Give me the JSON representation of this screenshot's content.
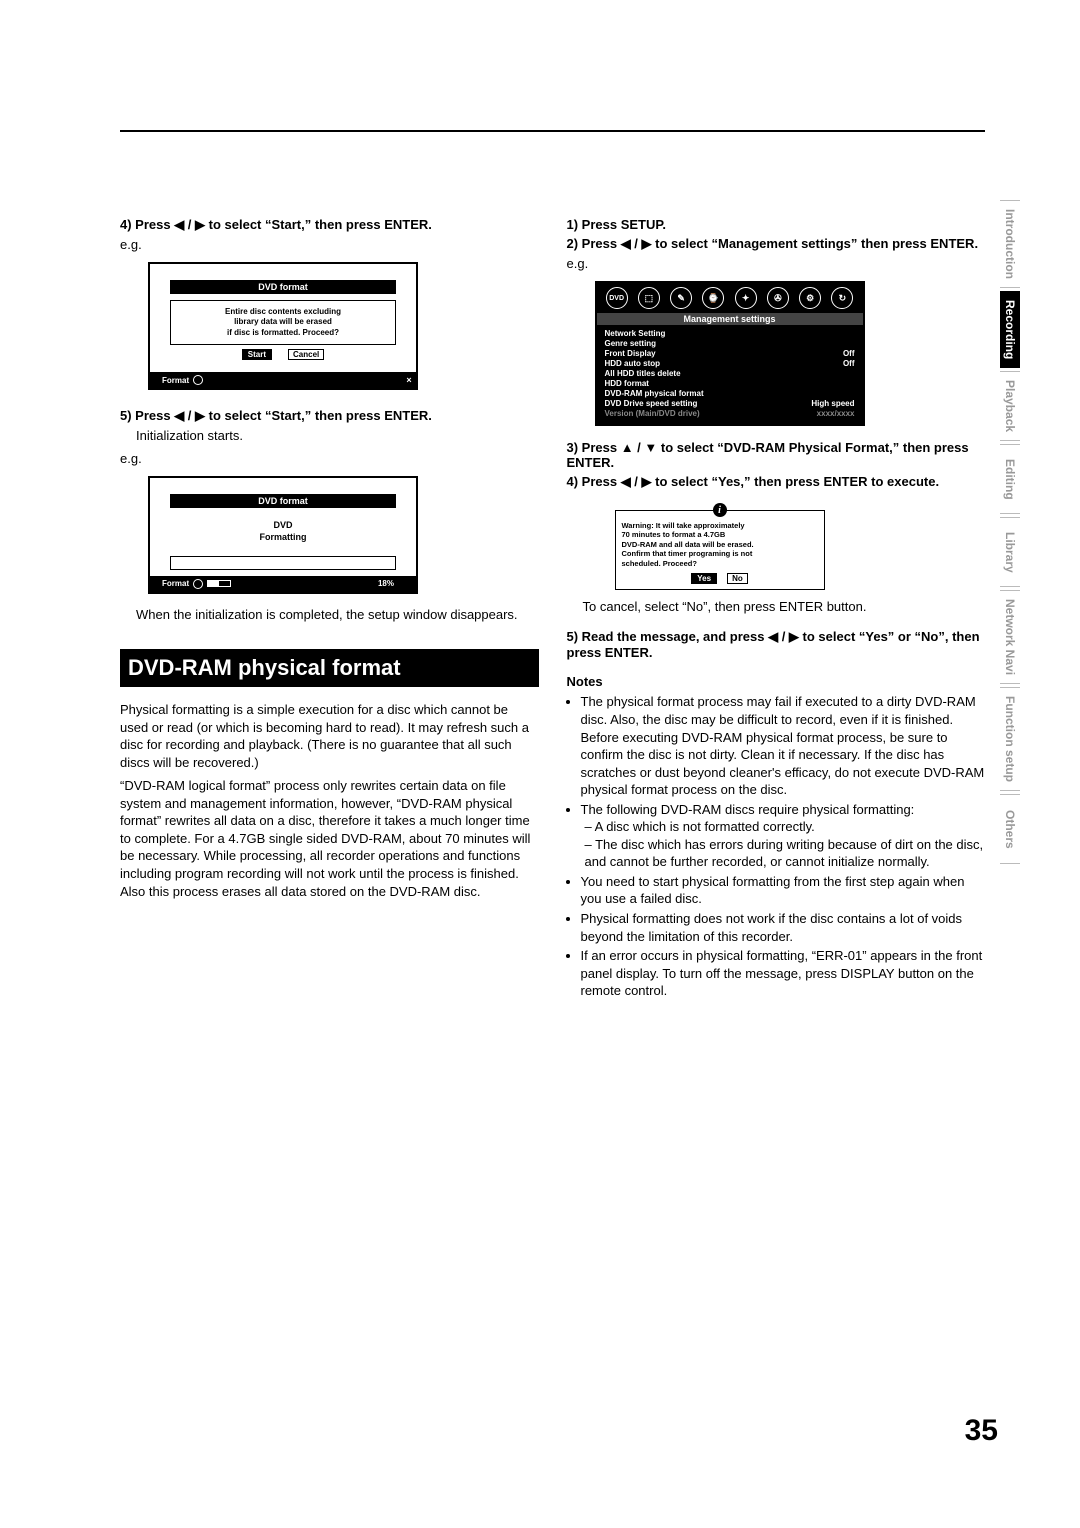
{
  "page_number": "35",
  "sidebar": [
    "Introduction",
    "Recording",
    "Playback",
    "Editing",
    "Library",
    "Network Navi",
    "Function setup",
    "Others"
  ],
  "sidebar_active": 1,
  "left": {
    "step4": "4) Press ◀ / ▶ to select “Start,” then press ENTER.",
    "eg": "e.g.",
    "diag1": {
      "title": "DVD format",
      "msg1": "Entire disc contents excluding",
      "msg2": "library data will be erased",
      "msg3": "if disc is formatted. Proceed?",
      "btn_start": "Start",
      "btn_cancel": "Cancel",
      "footer": "Format",
      "corner": "×"
    },
    "step5": "5) Press ◀ / ▶ to select “Start,” then press ENTER.",
    "step5_sub": "Initialization starts.",
    "diag2": {
      "title": "DVD format",
      "line1": "DVD",
      "line2": "Formatting",
      "footer": "Format",
      "percent": "18%"
    },
    "after": "When the initialization is completed, the setup window disappears.",
    "section": "DVD-RAM physical format",
    "body1": "Physical formatting is a simple execution for a disc which cannot be used or read (or which is becoming hard to read). It may refresh such a disc for recording and playback. (There is no guarantee that all such discs will be recovered.)",
    "body2": "“DVD-RAM logical format” process only rewrites certain data on file system and management information, however, “DVD-RAM physical format” rewrites all data on a disc, therefore it takes a much longer time to complete. For a 4.7GB single sided DVD-RAM, about 70 minutes will be necessary. While processing, all recorder operations and functions including program recording will not work until the process is finished. Also this process erases all data stored on the DVD-RAM disc."
  },
  "right": {
    "step1": "1) Press SETUP.",
    "step2": "2) Press ◀ / ▶ to select “Management settings” then press ENTER.",
    "eg": "e.g.",
    "mgmt": {
      "title": "Management settings",
      "rows": [
        {
          "l": "Network Setting",
          "v": ""
        },
        {
          "l": "Genre setting",
          "v": ""
        },
        {
          "l": "Front Display",
          "v": "Off"
        },
        {
          "l": "HDD auto stop",
          "v": "Off"
        },
        {
          "l": "All HDD titles delete",
          "v": ""
        },
        {
          "l": "HDD format",
          "v": ""
        },
        {
          "l": "DVD-RAM physical format",
          "v": ""
        },
        {
          "l": "DVD Drive speed setting",
          "v": "High speed"
        },
        {
          "l": "Version (Main/DVD drive)",
          "v": "xxxx/xxxx",
          "dim": true
        }
      ]
    },
    "step3": "3) Press ▲ / ▼ to select “DVD-RAM Physical Format,” then press ENTER.",
    "step4": "4) Press ◀ / ▶ to select “Yes,” then press ENTER to execute.",
    "info": {
      "l1": "Warning: It will take approximately",
      "l2": "70 minutes to format a 4.7GB",
      "l3": "DVD-RAM and all data will be erased.",
      "l4": "Confirm that timer programing is not",
      "l5": "scheduled. Proceed?",
      "yes": "Yes",
      "no": "No"
    },
    "cancel_text": "To cancel, select “No”, then press ENTER button.",
    "step5": "5) Read the message, and press ◀ / ▶ to select “Yes” or “No”, then press ENTER.",
    "notes_h": "Notes",
    "notes": [
      "The physical format process may fail if executed to a dirty DVD-RAM disc. Also, the disc may be difficult to record, even if it is finished. Before executing DVD-RAM physical format process, be sure to confirm the disc is not dirty. Clean it if necessary. If the disc has scratches or dust beyond cleaner's efficacy, do not execute DVD-RAM physical format process on the disc.",
      "The following DVD-RAM discs require physical formatting:",
      "You need to start physical formatting from the first step again when you use a failed disc.",
      "Physical formatting does not work if the disc contains a lot of voids beyond the limitation of this recorder.",
      "If an error occurs in physical formatting, “ERR-01” appears in the front panel display. To turn off the message, press DISPLAY button on the remote control."
    ],
    "notes_sub": [
      "A disc which is not formatted correctly.",
      "The disc which has errors during writing because of dirt on the disc, and cannot be further recorded, or cannot initialize normally."
    ]
  }
}
